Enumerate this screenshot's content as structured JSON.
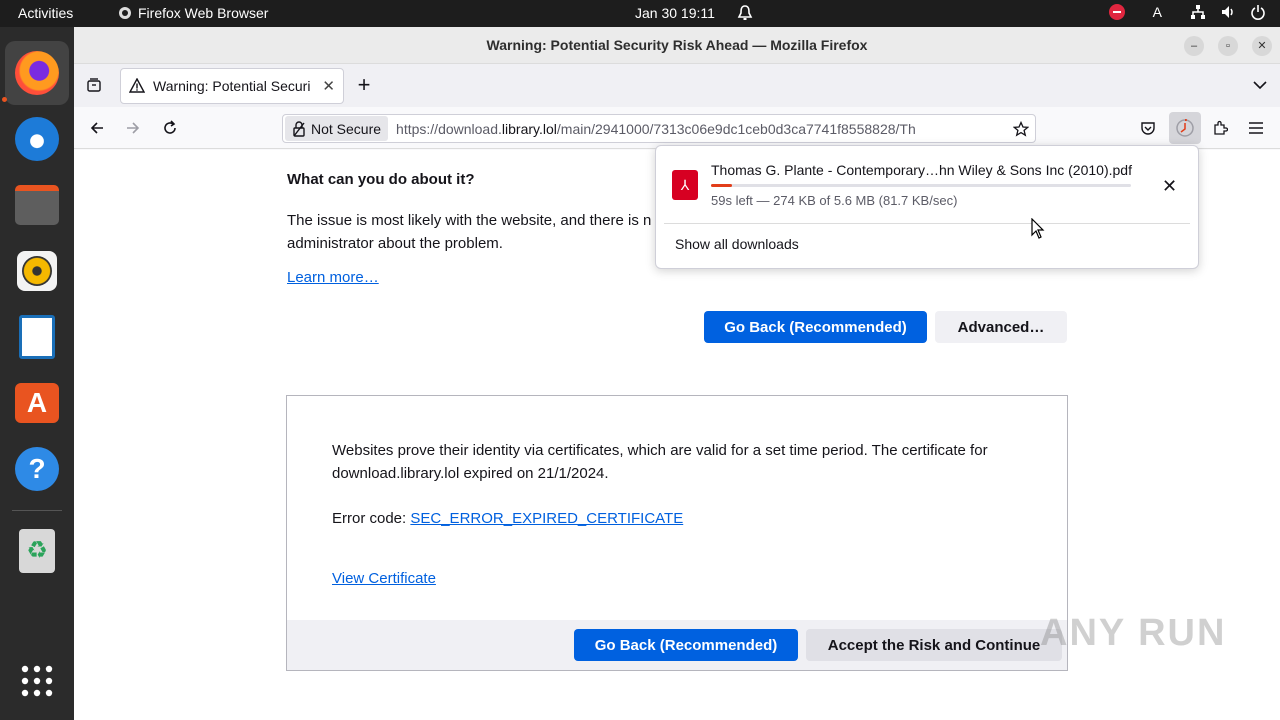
{
  "topbar": {
    "activities": "Activities",
    "app_name": "Firefox Web Browser",
    "clock": "Jan 30  19:11",
    "input_indicator": "A"
  },
  "dock": {
    "items": [
      "firefox-icon",
      "thunderbird-icon",
      "files-icon",
      "rhythmbox-icon",
      "libreoffice-writer-icon",
      "app-center-icon",
      "help-icon",
      "trash-icon",
      "show-apps-icon"
    ]
  },
  "window": {
    "title": "Warning: Potential Security Risk Ahead — Mozilla Firefox"
  },
  "tab": {
    "title": "Warning: Potential Securi"
  },
  "urlbar": {
    "security_label": "Not Secure",
    "url_prefix": "https://download.",
    "url_domain": "library.lol",
    "url_rest": "/main/2941000/7313c06e9dc1ceb0d3ca7741f8558828/Th"
  },
  "page": {
    "what_can_heading": "What can you do about it?",
    "issue_text": "The issue is most likely with the website, and there is n",
    "issue_text_2": "administrator about the problem.",
    "learn_more": "Learn more…",
    "go_back": "Go Back (Recommended)",
    "advanced": "Advanced…",
    "adv_text": "Websites prove their identity via certificates, which are valid for a set time period. The certificate for download.library.lol expired on 21/1/2024.",
    "error_code_label": "Error code: ",
    "error_code": "SEC_ERROR_EXPIRED_CERTIFICATE",
    "view_certificate": "View Certificate",
    "go_back_2": "Go Back (Recommended)",
    "accept_risk": "Accept the Risk and Continue"
  },
  "downloads": {
    "file_name": "Thomas G. Plante - Contemporary…hn Wiley & Sons Inc (2010).pdf",
    "status": "59s left — 274 KB of 5.6 MB (81.7 KB/sec)",
    "progress_fraction": 0.049,
    "show_all": "Show all downloads"
  },
  "watermark": "ANY RUN"
}
